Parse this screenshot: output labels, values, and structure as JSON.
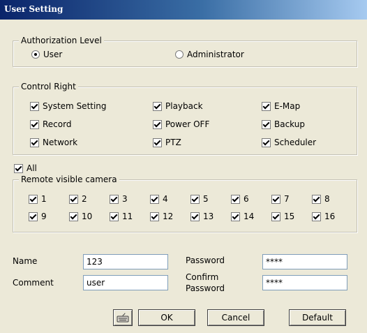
{
  "window": {
    "title": "User Setting"
  },
  "authorization": {
    "legend": "Authorization Level",
    "options": [
      {
        "label": "User",
        "selected": true
      },
      {
        "label": "Administrator",
        "selected": false
      }
    ]
  },
  "control_right": {
    "legend": "Control Right",
    "items": [
      {
        "label": "System Setting",
        "checked": true
      },
      {
        "label": "Playback",
        "checked": true
      },
      {
        "label": "E-Map",
        "checked": true
      },
      {
        "label": "Record",
        "checked": true
      },
      {
        "label": "Power OFF",
        "checked": true
      },
      {
        "label": "Backup",
        "checked": true
      },
      {
        "label": "Network",
        "checked": true
      },
      {
        "label": "PTZ",
        "checked": true
      },
      {
        "label": "Scheduler",
        "checked": true
      }
    ]
  },
  "all_checkbox": {
    "label": "All",
    "checked": true
  },
  "remote_camera": {
    "legend": "Remote visible camera",
    "cameras": [
      "1",
      "2",
      "3",
      "4",
      "5",
      "6",
      "7",
      "8",
      "9",
      "10",
      "11",
      "12",
      "13",
      "14",
      "15",
      "16"
    ]
  },
  "form": {
    "name_label": "Name",
    "name_value": "123",
    "comment_label": "Comment",
    "comment_value": "user",
    "password_label": "Password",
    "password_value": "****",
    "confirm_label_line1": "Confirm",
    "confirm_label_line2": "Password",
    "confirm_value": "****"
  },
  "buttons": {
    "icon": "keyboard-icon",
    "ok": "OK",
    "cancel": "Cancel",
    "default": "Default"
  },
  "colors": {
    "dialog_bg": "#ece9d8",
    "titlebar_start": "#0a246a",
    "titlebar_end": "#a6caf0"
  }
}
